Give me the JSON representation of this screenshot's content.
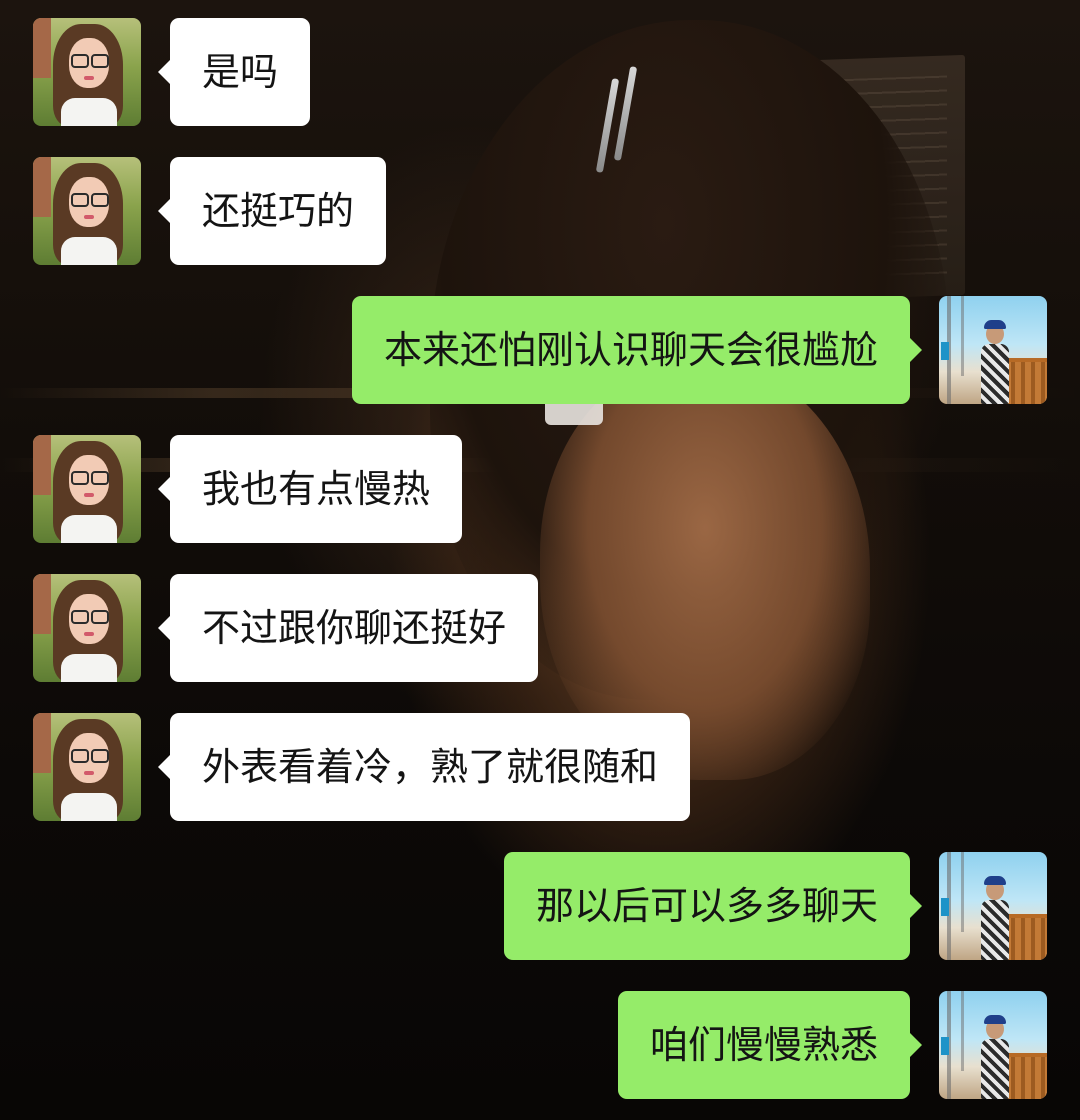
{
  "messages": [
    {
      "direction": "in",
      "text": "是吗"
    },
    {
      "direction": "in",
      "text": "还挺巧的"
    },
    {
      "direction": "out",
      "text": "本来还怕刚认识聊天会很尴尬"
    },
    {
      "direction": "in",
      "text": "我也有点慢热"
    },
    {
      "direction": "in",
      "text": "不过跟你聊还挺好"
    },
    {
      "direction": "in",
      "text": "外表看着冷，熟了就很随和"
    },
    {
      "direction": "out",
      "text": "那以后可以多多聊天"
    },
    {
      "direction": "out",
      "text": "咱们慢慢熟悉"
    }
  ],
  "colors": {
    "incoming_bubble": "#ffffff",
    "outgoing_bubble": "#95ec69",
    "text": "#141414"
  }
}
